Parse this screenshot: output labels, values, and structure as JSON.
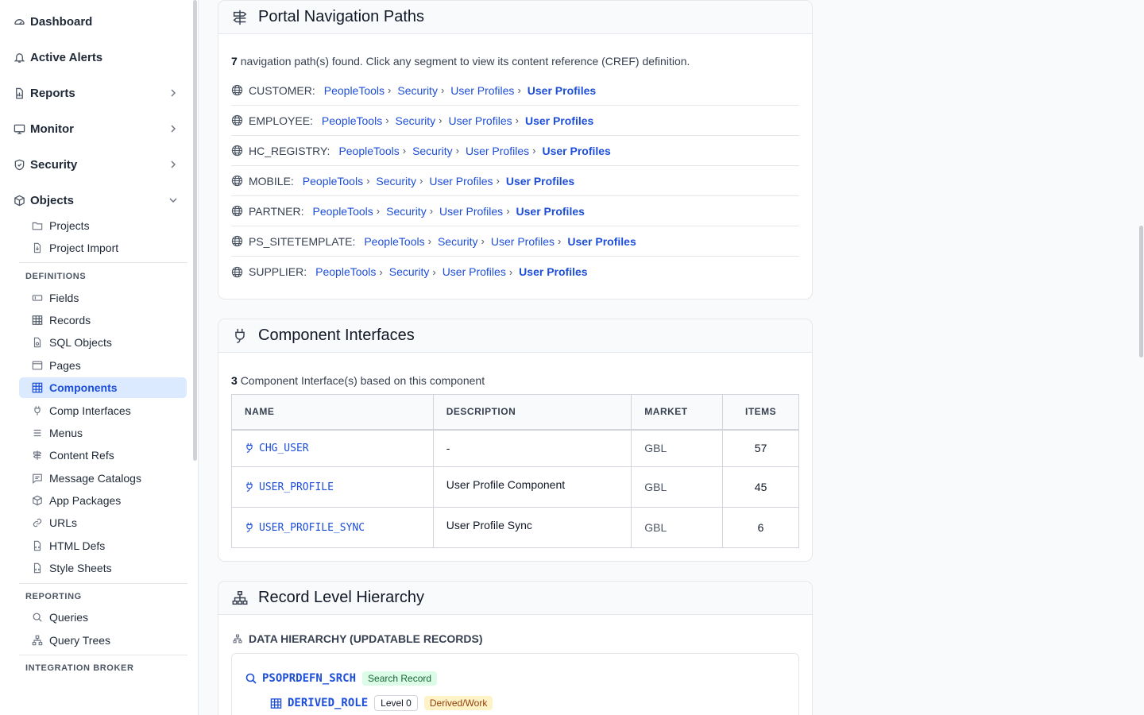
{
  "sidebar": {
    "top_items": [
      {
        "label": "Dashboard"
      },
      {
        "label": "Active Alerts"
      },
      {
        "label": "Reports"
      },
      {
        "label": "Monitor"
      },
      {
        "label": "Security"
      },
      {
        "label": "Objects"
      }
    ],
    "objects_items": [
      {
        "label": "Projects"
      },
      {
        "label": "Project Import"
      }
    ],
    "sections": {
      "definitions": "DEFINITIONS",
      "reporting": "REPORTING",
      "integration": "INTEGRATION BROKER"
    },
    "definitions_items": [
      {
        "label": "Fields"
      },
      {
        "label": "Records"
      },
      {
        "label": "SQL Objects"
      },
      {
        "label": "Pages"
      },
      {
        "label": "Components"
      },
      {
        "label": "Comp Interfaces"
      },
      {
        "label": "Menus"
      },
      {
        "label": "Content Refs"
      },
      {
        "label": "Message Catalogs"
      },
      {
        "label": "App Packages"
      },
      {
        "label": "URLs"
      },
      {
        "label": "HTML Defs"
      },
      {
        "label": "Style Sheets"
      }
    ],
    "reporting_items": [
      {
        "label": "Queries"
      },
      {
        "label": "Query Trees"
      }
    ]
  },
  "portal": {
    "title": "Portal Navigation Paths",
    "count": "7",
    "summary_text": "navigation path(s) found. Click any segment to view its content reference (CREF) definition.",
    "paths": [
      {
        "portal": "CUSTOMER:",
        "s1": "PeopleTools",
        "s2": "Security",
        "s3": "User Profiles",
        "final": "User Profiles"
      },
      {
        "portal": "EMPLOYEE:",
        "s1": "PeopleTools",
        "s2": "Security",
        "s3": "User Profiles",
        "final": "User Profiles"
      },
      {
        "portal": "HC_REGISTRY:",
        "s1": "PeopleTools",
        "s2": "Security",
        "s3": "User Profiles",
        "final": "User Profiles"
      },
      {
        "portal": "MOBILE:",
        "s1": "PeopleTools",
        "s2": "Security",
        "s3": "User Profiles",
        "final": "User Profiles"
      },
      {
        "portal": "PARTNER:",
        "s1": "PeopleTools",
        "s2": "Security",
        "s3": "User Profiles",
        "final": "User Profiles"
      },
      {
        "portal": "PS_SITETEMPLATE:",
        "s1": "PeopleTools",
        "s2": "Security",
        "s3": "User Profiles",
        "final": "User Profiles"
      },
      {
        "portal": "SUPPLIER:",
        "s1": "PeopleTools",
        "s2": "Security",
        "s3": "User Profiles",
        "final": "User Profiles"
      }
    ]
  },
  "ci": {
    "title": "Component Interfaces",
    "count": "3",
    "summary_text": "Component Interface(s) based on this component",
    "columns": {
      "name": "NAME",
      "description": "DESCRIPTION",
      "market": "MARKET",
      "items": "ITEMS"
    },
    "rows": [
      {
        "name": "CHG_USER",
        "description": "-",
        "market": "GBL",
        "items": "57"
      },
      {
        "name": "USER_PROFILE",
        "description": "User Profile Component",
        "market": "GBL",
        "items": "45"
      },
      {
        "name": "USER_PROFILE_SYNC",
        "description": "User Profile Sync",
        "market": "GBL",
        "items": "6"
      }
    ]
  },
  "hierarchy": {
    "title": "Record Level Hierarchy",
    "subtitle": "DATA HIERARCHY (UPDATABLE RECORDS)",
    "search_record": {
      "name": "PSOPRDEFN_SRCH",
      "badge": "Search Record"
    },
    "level0": {
      "name": "DERIVED_ROLE",
      "level": "Level 0",
      "type": "Derived/Work"
    }
  },
  "colors": {
    "accent": "#1d4ed8",
    "active_bg": "#dbeafe"
  }
}
